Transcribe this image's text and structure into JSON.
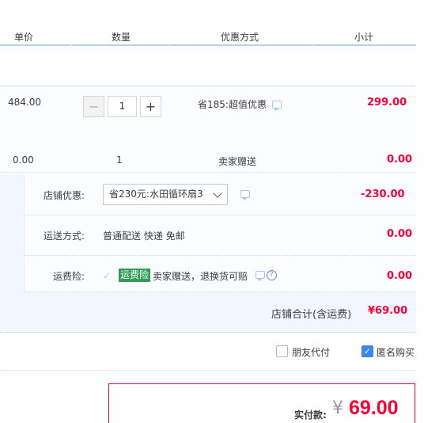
{
  "header": {
    "col_unit_price": "单价",
    "col_quantity": "数量",
    "col_promo": "优惠方式",
    "col_subtotal": "小计"
  },
  "item1": {
    "unit_price": "484.00",
    "quantity": "1",
    "promo": "省185:超值优惠",
    "subtotal": "299.00"
  },
  "item2": {
    "unit_price": "0.00",
    "quantity": "1",
    "promo": "卖家赠送",
    "subtotal": "0.00"
  },
  "shop": {
    "coupon_label": "店铺优惠:",
    "coupon_selected": "省230元:水田循环扇3",
    "coupon_amount": "-230.00",
    "shipping_label": "运送方式:",
    "shipping_value": "普通配送 快递 免邮",
    "shipping_amount": "0.00",
    "insurance_label": "运费险:",
    "insurance_badge": "运费险",
    "insurance_desc": "卖家赠送，退换货可赔",
    "insurance_amount": "0.00",
    "total_label": "店铺合计(含运费)",
    "total_value": "¥69.00"
  },
  "options": {
    "friend_pay": "朋友代付",
    "friend_pay_checked": false,
    "anonymous": "匿名购买",
    "anonymous_checked": true
  },
  "payment": {
    "label": "实付款:",
    "currency": "¥",
    "amount": "69.00"
  },
  "icons": {
    "message": "message-icon",
    "help": "help-icon",
    "check": "check-icon"
  },
  "colors": {
    "accent_red": "#ff0036",
    "accent_blue": "#3e83f4",
    "insurance_green": "#2d9e57"
  }
}
